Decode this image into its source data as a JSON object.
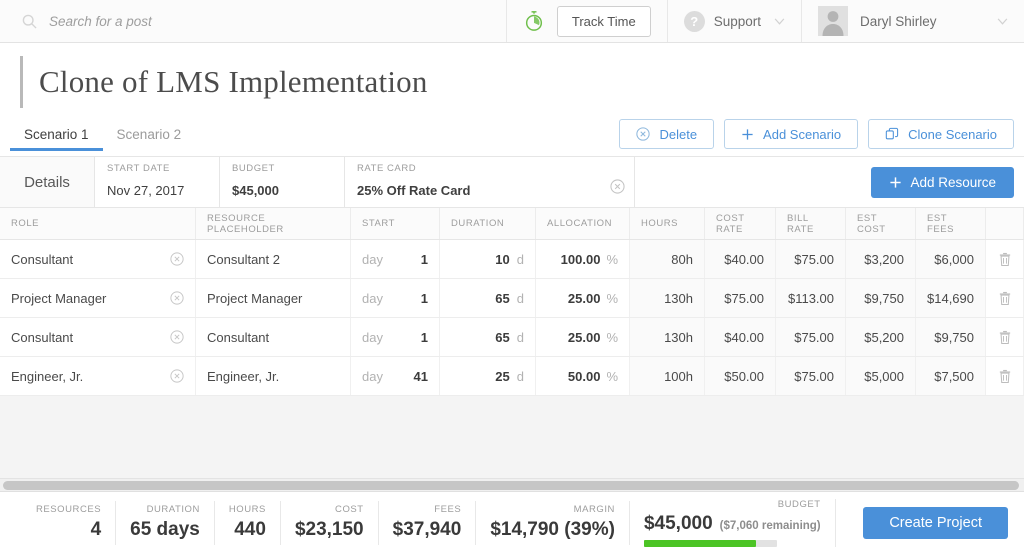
{
  "topbar": {
    "search": {
      "placeholder": "Search for a post",
      "value": "",
      "icon": "search-icon"
    },
    "stopwatch_icon": "stopwatch-icon",
    "track_time_label": "Track Time",
    "support_label": "Support",
    "support_icon": "question-mark-icon",
    "user_name": "Daryl Shirley",
    "avatar_icon": "user-avatar-icon",
    "caret_icon": "chevron-down-icon"
  },
  "header": {
    "title": "Clone of LMS Implementation"
  },
  "tabs": [
    {
      "label": "Scenario 1",
      "active": true
    },
    {
      "label": "Scenario 2",
      "active": false
    }
  ],
  "actions": [
    {
      "label": "Delete",
      "icon": "circle-x-icon"
    },
    {
      "label": "Add Scenario",
      "icon": "plus-icon"
    },
    {
      "label": "Clone Scenario",
      "icon": "copy-icon"
    }
  ],
  "details": {
    "section_label": "Details",
    "fields": [
      {
        "header": "START DATE",
        "value": "Nov 27, 2017",
        "bold": false
      },
      {
        "header": "BUDGET",
        "value": "$45,000",
        "bold": true
      },
      {
        "header": "RATE CARD",
        "value": "25% Off Rate Card",
        "bold": true,
        "clear_icon": "circle-x-icon"
      }
    ],
    "add_resource_label": "Add Resource",
    "add_resource_icon": "plus-icon"
  },
  "table": {
    "columns": [
      "ROLE",
      "RESOURCE PLACEHOLDER",
      "START",
      "DURATION",
      "ALLOCATION",
      "HOURS",
      "COST RATE",
      "BILL RATE",
      "EST COST",
      "EST FEES",
      ""
    ],
    "rows": [
      {
        "role": "Consultant",
        "role_clear_icon": "circle-x-icon",
        "resource": "Consultant 2",
        "start_unit": "day",
        "start_value": "1",
        "duration_value": "10",
        "duration_unit": "d",
        "allocation_value": "100.00",
        "allocation_unit": "%",
        "hours": "80h",
        "cost_rate": "$40.00",
        "bill_rate": "$75.00",
        "est_cost": "$3,200",
        "est_fees": "$6,000",
        "delete_icon": "trash-icon"
      },
      {
        "role": "Project Manager",
        "role_clear_icon": "circle-x-icon",
        "resource": "Project Manager",
        "start_unit": "day",
        "start_value": "1",
        "duration_value": "65",
        "duration_unit": "d",
        "allocation_value": "25.00",
        "allocation_unit": "%",
        "hours": "130h",
        "cost_rate": "$75.00",
        "bill_rate": "$113.00",
        "est_cost": "$9,750",
        "est_fees": "$14,690",
        "delete_icon": "trash-icon"
      },
      {
        "role": "Consultant",
        "role_clear_icon": "circle-x-icon",
        "resource": "Consultant",
        "start_unit": "day",
        "start_value": "1",
        "duration_value": "65",
        "duration_unit": "d",
        "allocation_value": "25.00",
        "allocation_unit": "%",
        "hours": "130h",
        "cost_rate": "$40.00",
        "bill_rate": "$75.00",
        "est_cost": "$5,200",
        "est_fees": "$9,750",
        "delete_icon": "trash-icon"
      },
      {
        "role": "Engineer, Jr.",
        "role_clear_icon": "circle-x-icon",
        "resource": "Engineer, Jr.",
        "start_unit": "day",
        "start_value": "41",
        "duration_value": "25",
        "duration_unit": "d",
        "allocation_value": "50.00",
        "allocation_unit": "%",
        "hours": "100h",
        "cost_rate": "$50.00",
        "bill_rate": "$75.00",
        "est_cost": "$5,000",
        "est_fees": "$7,500",
        "delete_icon": "trash-icon"
      }
    ]
  },
  "footer": {
    "stats": [
      {
        "label": "RESOURCES",
        "value": "4"
      },
      {
        "label": "DURATION",
        "value": "65 days"
      },
      {
        "label": "HOURS",
        "value": "440"
      },
      {
        "label": "COST",
        "value": "$23,150"
      },
      {
        "label": "FEES",
        "value": "$37,940"
      },
      {
        "label": "MARGIN",
        "value": "$14,790 (39%)"
      }
    ],
    "budget": {
      "label": "BUDGET",
      "value": "$45,000",
      "remaining": "($7,060 remaining)",
      "progress_percent": 84,
      "bar_color": "#4cc425"
    },
    "create_project_label": "Create Project"
  },
  "colors": {
    "accent_blue": "#4a90d9",
    "progress_green": "#4cc425",
    "text_dark": "#3a3a3a",
    "text_muted": "#9d9d9d"
  }
}
